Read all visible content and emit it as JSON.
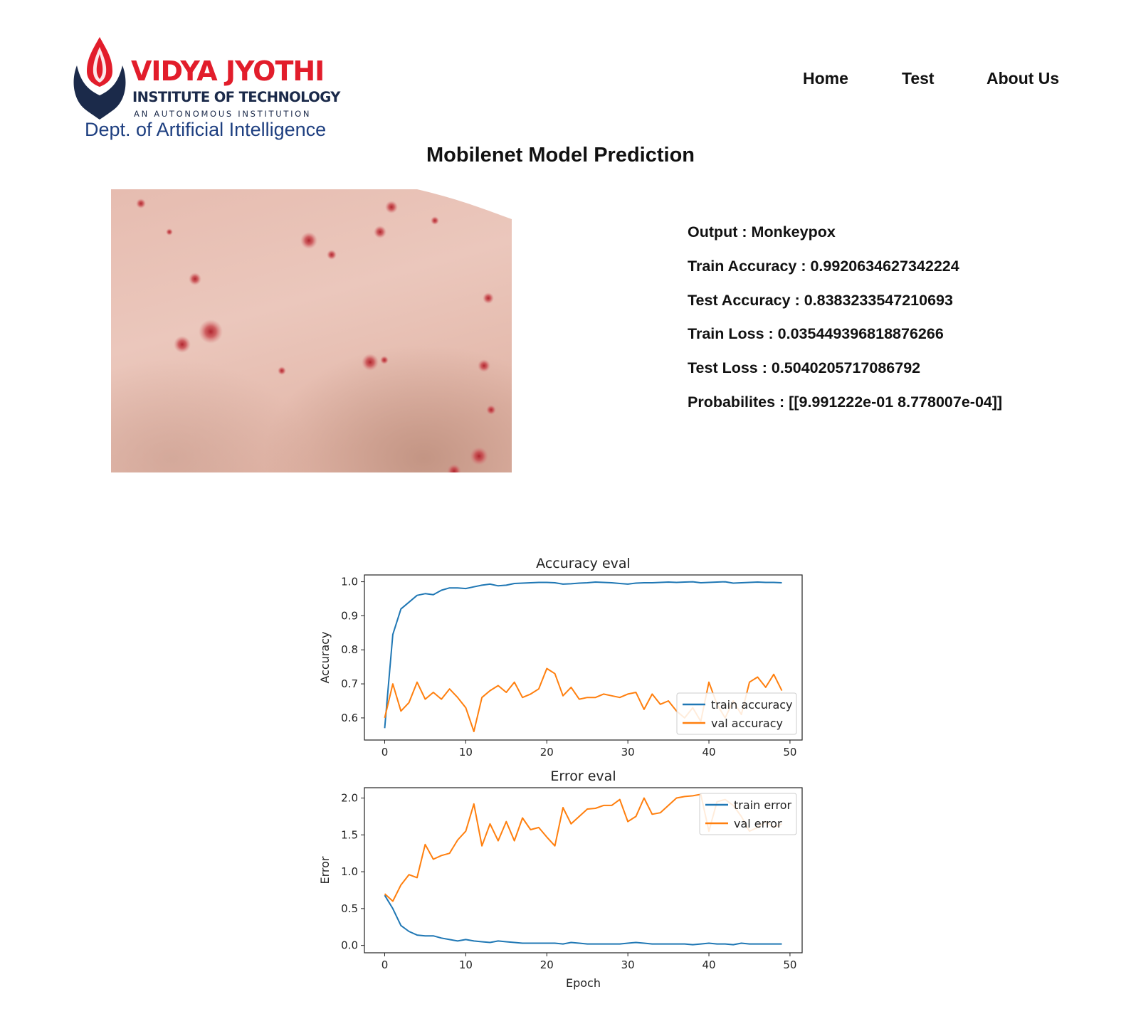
{
  "header": {
    "logo": {
      "title": "VIDYA JYOTHI",
      "subtitle": "INSTITUTE OF TECHNOLOGY",
      "tagline": "AN AUTONOMOUS INSTITUTION",
      "department": "Dept. of Artificial Intelligence"
    },
    "nav": [
      "Home",
      "Test",
      "About Us"
    ]
  },
  "page": {
    "title": "Mobilenet Model Prediction"
  },
  "results": [
    "Output : Monkeypox",
    "Train Accuracy : 0.9920634627342224",
    "Test Accuracy : 0.8383233547210693",
    "Train Loss : 0.035449396818876266",
    "Test Loss : 0.5040205717086792",
    "Probabilites : [[9.991222e-01 8.778007e-04]]"
  ],
  "colors": {
    "brand_red": "#e21d2b",
    "brand_navy": "#1b2a4a",
    "dept_blue": "#1e3f80",
    "train_series": "#1f77b4",
    "val_series": "#ff7f0e"
  },
  "chart_data": [
    {
      "type": "line",
      "title": "Accuracy eval",
      "xlabel": "",
      "ylabel": "Accuracy",
      "xlim": [
        -2.5,
        51.5
      ],
      "ylim": [
        0.535,
        1.02
      ],
      "xticks": [
        0,
        10,
        20,
        30,
        40,
        50
      ],
      "xtick_labels": [
        "0",
        "10",
        "20",
        "30",
        "40",
        "50"
      ],
      "yticks": [
        0.6,
        0.7,
        0.8,
        0.9,
        1.0
      ],
      "ytick_labels": [
        "0.6",
        "0.7",
        "0.8",
        "0.9",
        "1.0"
      ],
      "legend_position": "lower-right",
      "grid": false,
      "x": [
        0,
        1,
        2,
        3,
        4,
        5,
        6,
        7,
        8,
        9,
        10,
        11,
        12,
        13,
        14,
        15,
        16,
        17,
        18,
        19,
        20,
        21,
        22,
        23,
        24,
        25,
        26,
        27,
        28,
        29,
        30,
        31,
        32,
        33,
        34,
        35,
        36,
        37,
        38,
        39,
        40,
        41,
        42,
        43,
        44,
        45,
        46,
        47,
        48,
        49
      ],
      "series": [
        {
          "name": "train accuracy",
          "color": "#1f77b4",
          "values": [
            0.57,
            0.845,
            0.92,
            0.94,
            0.96,
            0.965,
            0.962,
            0.975,
            0.982,
            0.982,
            0.98,
            0.985,
            0.99,
            0.993,
            0.988,
            0.99,
            0.995,
            0.996,
            0.997,
            0.998,
            0.998,
            0.997,
            0.993,
            0.994,
            0.996,
            0.997,
            0.999,
            0.998,
            0.997,
            0.995,
            0.993,
            0.996,
            0.997,
            0.997,
            0.998,
            0.999,
            0.998,
            0.999,
            1.0,
            0.997,
            0.998,
            0.999,
            1.0,
            0.996,
            0.997,
            0.998,
            0.999,
            0.998,
            0.998,
            0.997
          ]
        },
        {
          "name": "val accuracy",
          "color": "#ff7f0e",
          "values": [
            0.6,
            0.7,
            0.62,
            0.645,
            0.705,
            0.655,
            0.675,
            0.655,
            0.685,
            0.66,
            0.63,
            0.56,
            0.66,
            0.68,
            0.695,
            0.675,
            0.705,
            0.66,
            0.67,
            0.685,
            0.745,
            0.73,
            0.665,
            0.69,
            0.655,
            0.66,
            0.66,
            0.67,
            0.665,
            0.66,
            0.67,
            0.675,
            0.625,
            0.67,
            0.64,
            0.65,
            0.62,
            0.6,
            0.63,
            0.59,
            0.705,
            0.64,
            0.6,
            0.65,
            0.61,
            0.705,
            0.72,
            0.69,
            0.728,
            0.68
          ]
        }
      ]
    },
    {
      "type": "line",
      "title": "Error eval",
      "xlabel": "Epoch",
      "ylabel": "Error",
      "xlim": [
        -2.5,
        51.5
      ],
      "ylim": [
        -0.1,
        2.14
      ],
      "xticks": [
        0,
        10,
        20,
        30,
        40,
        50
      ],
      "xtick_labels": [
        "0",
        "10",
        "20",
        "30",
        "40",
        "50"
      ],
      "yticks": [
        0.0,
        0.5,
        1.0,
        1.5,
        2.0
      ],
      "ytick_labels": [
        "0.0",
        "0.5",
        "1.0",
        "1.5",
        "2.0"
      ],
      "legend_position": "upper-right",
      "grid": false,
      "x": [
        0,
        1,
        2,
        3,
        4,
        5,
        6,
        7,
        8,
        9,
        10,
        11,
        12,
        13,
        14,
        15,
        16,
        17,
        18,
        19,
        20,
        21,
        22,
        23,
        24,
        25,
        26,
        27,
        28,
        29,
        30,
        31,
        32,
        33,
        34,
        35,
        36,
        37,
        38,
        39,
        40,
        41,
        42,
        43,
        44,
        45,
        46,
        47,
        48,
        49
      ],
      "series": [
        {
          "name": "train error",
          "color": "#1f77b4",
          "values": [
            0.68,
            0.5,
            0.27,
            0.19,
            0.14,
            0.13,
            0.13,
            0.1,
            0.08,
            0.06,
            0.08,
            0.06,
            0.05,
            0.04,
            0.06,
            0.05,
            0.04,
            0.03,
            0.03,
            0.03,
            0.03,
            0.03,
            0.02,
            0.04,
            0.03,
            0.02,
            0.02,
            0.02,
            0.02,
            0.02,
            0.03,
            0.04,
            0.03,
            0.02,
            0.02,
            0.02,
            0.02,
            0.02,
            0.01,
            0.02,
            0.03,
            0.02,
            0.02,
            0.01,
            0.03,
            0.02,
            0.02,
            0.02,
            0.02,
            0.02
          ]
        },
        {
          "name": "val error",
          "color": "#ff7f0e",
          "values": [
            0.7,
            0.6,
            0.82,
            0.96,
            0.92,
            1.37,
            1.17,
            1.22,
            1.25,
            1.43,
            1.55,
            1.92,
            1.35,
            1.65,
            1.42,
            1.68,
            1.42,
            1.73,
            1.57,
            1.6,
            1.47,
            1.35,
            1.87,
            1.65,
            1.75,
            1.85,
            1.86,
            1.9,
            1.9,
            1.98,
            1.68,
            1.75,
            2.0,
            1.78,
            1.8,
            1.9,
            2.0,
            2.02,
            2.03,
            2.05,
            1.55,
            1.95,
            1.98,
            1.9,
            1.75,
            1.55,
            1.6,
            1.68,
            1.6,
            1.65
          ]
        }
      ]
    }
  ]
}
